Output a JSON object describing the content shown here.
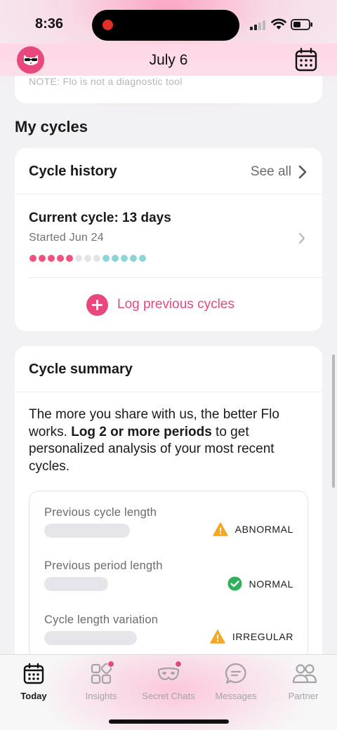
{
  "status_bar": {
    "time": "8:36"
  },
  "header": {
    "title": "July 6"
  },
  "top_note": "NOTE: Flo is not a diagnostic tool",
  "section_title": "My cycles",
  "cycle_history": {
    "title": "Cycle history",
    "see_all": "See all",
    "current_title": "Current cycle: 13 days",
    "current_sub": "Started Jun 24",
    "dots": [
      "#f0517f",
      "#f0517f",
      "#f0517f",
      "#f0517f",
      "#f0517f",
      "#e4e4e8",
      "#e4e4e8",
      "#e4e4e8",
      "#8ed3d6",
      "#8ed3d6",
      "#8ed3d6",
      "#8ed3d6",
      "#8ed3d6"
    ],
    "log_label": "Log previous cycles"
  },
  "cycle_summary": {
    "title": "Cycle summary",
    "text_pre": "The more you share with us, the better Flo works. ",
    "text_bold": "Log 2 or more periods",
    "text_post": " to get personalized analysis of your most recent cycles.",
    "metrics": [
      {
        "label": "Previous cycle length",
        "status": "ABNORMAL",
        "status_icon": "warning-icon"
      },
      {
        "label": "Previous period length",
        "status": "NORMAL",
        "status_icon": "check-icon"
      },
      {
        "label": "Cycle length variation",
        "status": "IRREGULAR",
        "status_icon": "warning-icon"
      }
    ]
  },
  "tabs": [
    {
      "label": "Today",
      "icon": "calendar-icon",
      "active": true
    },
    {
      "label": "Insights",
      "icon": "insights-icon",
      "active": false
    },
    {
      "label": "Secret Chats",
      "icon": "mask-icon",
      "active": false
    },
    {
      "label": "Messages",
      "icon": "message-icon",
      "active": false
    },
    {
      "label": "Partner",
      "icon": "partner-icon",
      "active": false
    }
  ],
  "colors": {
    "accent": "#e8487c",
    "warning": "#f5a623",
    "success": "#2fb05a"
  }
}
